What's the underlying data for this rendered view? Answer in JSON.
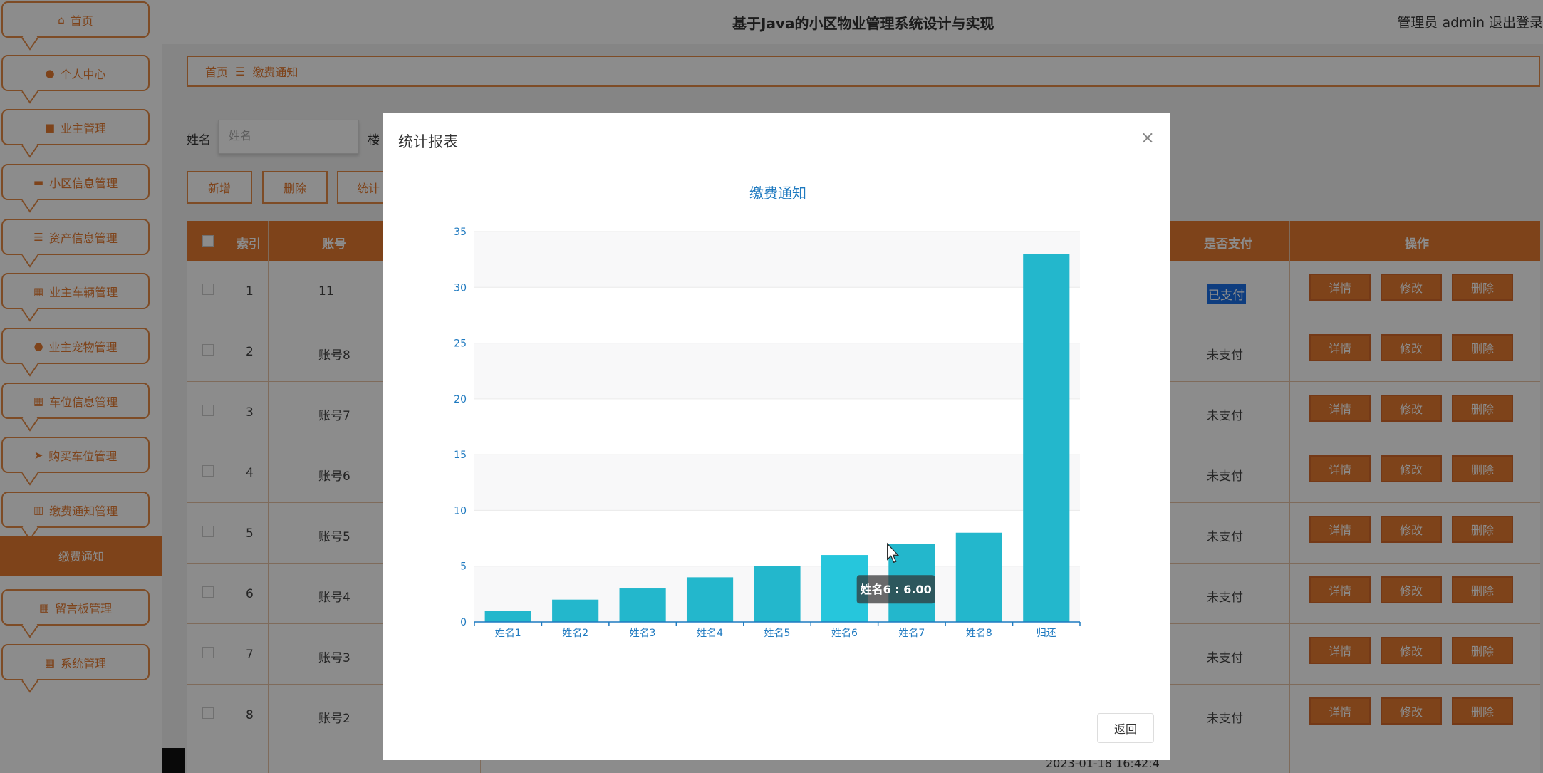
{
  "sidebar": {
    "items": [
      {
        "label": "首页",
        "icon": "home-icon",
        "glyph": "⌂"
      },
      {
        "label": "个人中心",
        "icon": "user-icon",
        "glyph": "●"
      },
      {
        "label": "业主管理",
        "icon": "briefcase-icon",
        "glyph": "■"
      },
      {
        "label": "小区信息管理",
        "icon": "monitor-icon",
        "glyph": "▬"
      },
      {
        "label": "资产信息管理",
        "icon": "list-icon",
        "glyph": "☰"
      },
      {
        "label": "业主车辆管理",
        "icon": "grid-icon",
        "glyph": "▦"
      },
      {
        "label": "业主宠物管理",
        "icon": "user-icon",
        "glyph": "●"
      },
      {
        "label": "车位信息管理",
        "icon": "grid-icon",
        "glyph": "▦"
      },
      {
        "label": "购买车位管理",
        "icon": "send-icon",
        "glyph": "➤"
      },
      {
        "label": "缴费通知管理",
        "icon": "bar-chart-icon",
        "glyph": "▥"
      }
    ],
    "active_sub": "缴费通知",
    "items_after": [
      {
        "label": "留言板管理",
        "icon": "grid-icon",
        "glyph": "▦"
      },
      {
        "label": "系统管理",
        "icon": "grid-icon",
        "glyph": "▦"
      }
    ]
  },
  "header": {
    "title": "基于Java的小区物业管理系统设计与实现",
    "user": "管理员 admin",
    "logout": "退出登录"
  },
  "breadcrumb": {
    "home": "首页",
    "separator": "☰",
    "current": "缴费通知"
  },
  "search": {
    "name_label": "姓名",
    "name_placeholder": "姓名",
    "building_label": "楼"
  },
  "toolbar": {
    "add": "新增",
    "delete": "删除",
    "stats": "统计"
  },
  "table": {
    "headers": {
      "index": "索引",
      "account": "账号",
      "paid": "是否支付",
      "actions": "操作"
    },
    "rows": [
      {
        "index": "1",
        "account": "11",
        "paid": "已支付"
      },
      {
        "index": "2",
        "account": "账号8",
        "paid": "未支付"
      },
      {
        "index": "3",
        "account": "账号7",
        "paid": "未支付"
      },
      {
        "index": "4",
        "account": "账号6",
        "paid": "未支付"
      },
      {
        "index": "5",
        "account": "账号5",
        "paid": "未支付"
      },
      {
        "index": "6",
        "account": "账号4",
        "paid": "未支付"
      },
      {
        "index": "7",
        "account": "账号3",
        "paid": "未支付"
      },
      {
        "index": "8",
        "account": "账号2",
        "paid": "未支付"
      }
    ],
    "action_labels": {
      "detail": "详情",
      "edit": "修改",
      "delete": "删除"
    },
    "partial_timestamp": "2023-01-18 16:42:4"
  },
  "dialog": {
    "title": "统计报表",
    "close": "×",
    "return_label": "返回"
  },
  "colors": {
    "accent": "#e57a30",
    "bar": "#23b7cc",
    "bar_hover": "#26c6dc",
    "axis": "#1f7ac0"
  },
  "chart_data": {
    "type": "bar",
    "title": "缴费通知",
    "categories": [
      "姓名1",
      "姓名2",
      "姓名3",
      "姓名4",
      "姓名5",
      "姓名6",
      "姓名7",
      "姓名8",
      "归还"
    ],
    "values": [
      1,
      2,
      3,
      4,
      5,
      6,
      7,
      8,
      33
    ],
    "ylim": [
      0,
      35
    ],
    "yticks": [
      0,
      5,
      10,
      15,
      20,
      25,
      30,
      35
    ],
    "grid": true,
    "tooltip": "姓名6 : 6.00"
  }
}
